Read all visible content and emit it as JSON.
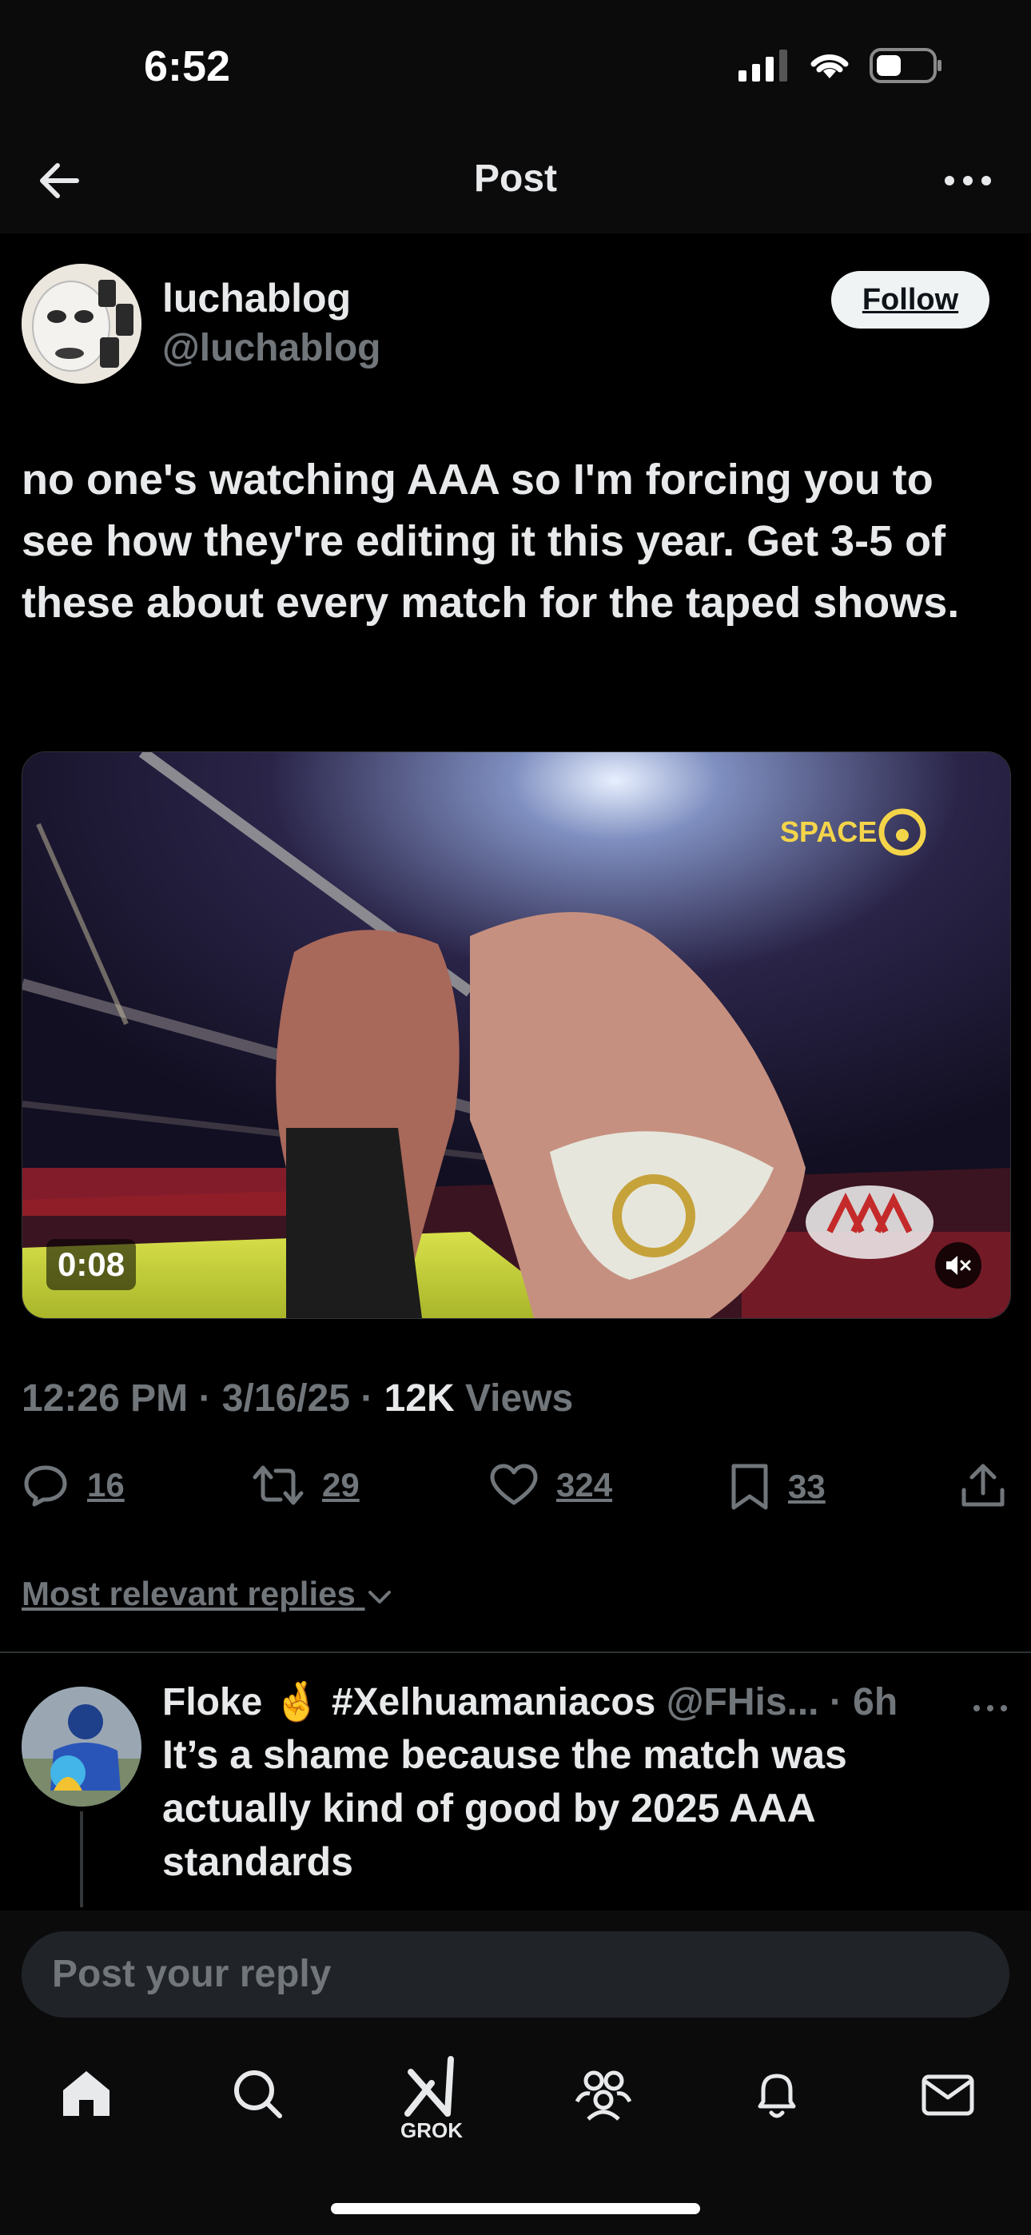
{
  "status_bar": {
    "time": "6:52"
  },
  "header": {
    "title": "Post"
  },
  "post": {
    "display_name": "luchablog",
    "handle": "@luchablog",
    "follow_label": "Follow",
    "text": "no one's watching AAA so I'm forcing you to see how they're editing it this year. Get 3-5 of these about every match for the taped shows.",
    "video": {
      "duration": "0:08",
      "watermark": "SPACE"
    },
    "time": "12:26 PM",
    "date": "3/16/25",
    "views_count": "12K",
    "views_label": "Views",
    "separator": "·"
  },
  "actions": {
    "replies": "16",
    "reposts": "29",
    "likes": "324",
    "bookmarks": "33"
  },
  "replies_sort": {
    "label": "Most relevant replies"
  },
  "reply": {
    "display_name": "Floke",
    "emoji": "🤞",
    "hashtag": "#Xelhuamaniacos",
    "handle": "@FHis...",
    "time": "· 6h",
    "text": "It’s a shame because the match was actually kind of good by 2025 AAA standards"
  },
  "composer": {
    "placeholder": "Post your reply"
  },
  "tabbar": {
    "grok_label": "GROK"
  },
  "colors": {
    "background": "#000000",
    "muted": "#71767b",
    "text": "#e7e9ea"
  }
}
